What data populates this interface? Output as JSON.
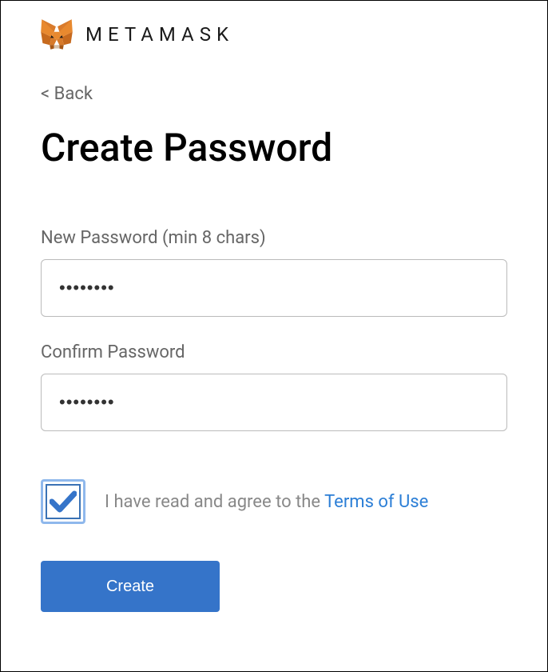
{
  "brand": "METAMASK",
  "back_label": "< Back",
  "page_title": "Create Password",
  "fields": {
    "new_password": {
      "label": "New Password (min 8 chars)",
      "value": "••••••••"
    },
    "confirm_password": {
      "label": "Confirm Password",
      "value": "••••••••"
    }
  },
  "agreement": {
    "text_prefix": "I have read and agree to the ",
    "link_text": "Terms of Use",
    "checked": true
  },
  "create_button_label": "Create"
}
